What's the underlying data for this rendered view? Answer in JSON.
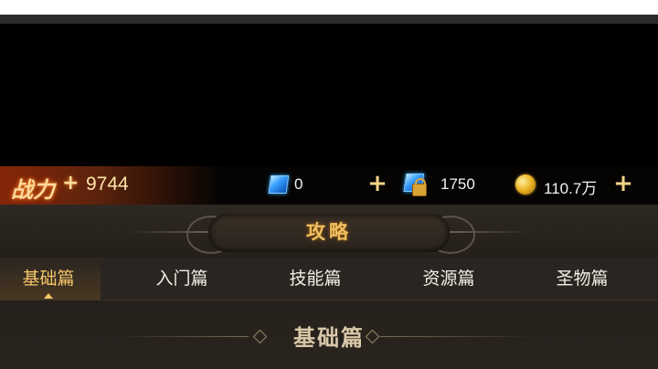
{
  "resources": {
    "power_label": "战力",
    "power_plus": "+",
    "power_value": "9744",
    "gem_free_value": "0",
    "gem_bound_value": "1750",
    "gold_value": "110.7万",
    "add_symbol": "+"
  },
  "header": {
    "title": "攻略"
  },
  "tabs": [
    {
      "label": "基础篇",
      "active": true
    },
    {
      "label": "入门篇",
      "active": false
    },
    {
      "label": "技能篇",
      "active": false
    },
    {
      "label": "资源篇",
      "active": false
    },
    {
      "label": "圣物篇",
      "active": false
    }
  ],
  "section": {
    "title": "基础篇"
  },
  "icons": {
    "gem": "blue-gem-icon",
    "locked_gem": "locked-gem-icon",
    "coin": "gold-coin-icon"
  },
  "colors": {
    "accent_gold": "#f6c66a",
    "title_gold": "#f0c060",
    "panel_bg": "#2a2520"
  }
}
